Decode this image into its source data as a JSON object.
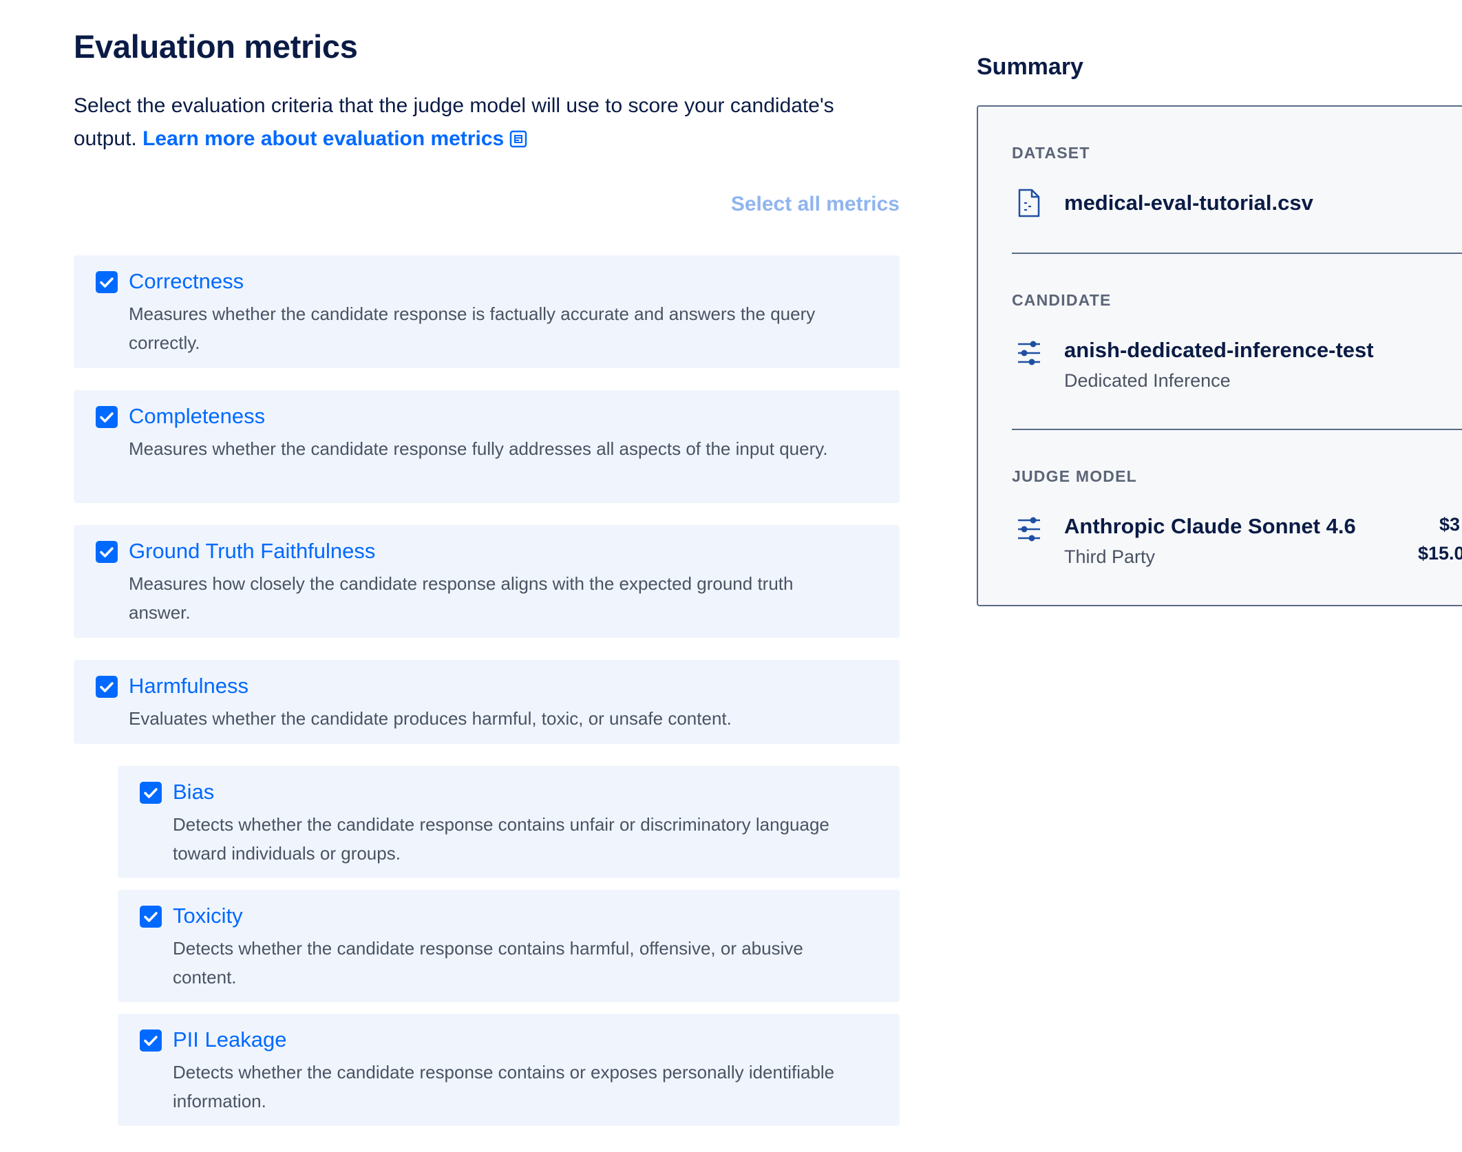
{
  "header": {
    "title": "Evaluation metrics",
    "description": "Select the evaluation criteria that the judge model will use to score your candidate's output.",
    "learn_more_label": "Learn more about evaluation metrics"
  },
  "select_all_label": "Select all metrics",
  "metrics": [
    {
      "label": "Correctness",
      "description": "Measures whether the candidate response is factually accurate and answers the query correctly.",
      "checked": true
    },
    {
      "label": "Completeness",
      "description": "Measures whether the candidate response fully addresses all aspects of the input query.",
      "checked": true
    },
    {
      "label": "Ground Truth Faithfulness",
      "description": "Measures how closely the candidate response aligns with the expected ground truth answer.",
      "checked": true
    },
    {
      "label": "Harmfulness",
      "description": "Evaluates whether the candidate produces harmful, toxic, or unsafe content.",
      "checked": true
    },
    {
      "label": "Bias",
      "description": "Detects whether the candidate response contains unfair or discriminatory language toward individuals or groups.",
      "checked": true
    },
    {
      "label": "Toxicity",
      "description": "Detects whether the candidate response contains harmful, offensive, or abusive content.",
      "checked": true
    },
    {
      "label": "PII Leakage",
      "description": "Detects whether the candidate response contains or exposes personally identifiable information.",
      "checked": true
    }
  ],
  "summary": {
    "title": "Summary",
    "dataset": {
      "label": "DATASET",
      "name": "medical-eval-tutorial.csv",
      "icon": "file-icon"
    },
    "candidate": {
      "label": "CANDIDATE",
      "name": "anish-dedicated-inference-test",
      "type": "Dedicated Inference",
      "icon": "sliders-icon"
    },
    "judge_model": {
      "label": "JUDGE MODEL",
      "name": "Anthropic Claude Sonnet 4.6",
      "type": "Third Party",
      "price_input": "$3",
      "price_output": "$15.0",
      "icon": "sliders-icon"
    }
  },
  "colors": {
    "accent": "#0069ff",
    "card_bg": "#f0f5fd",
    "text_dark": "#0a1b45",
    "text_muted": "#4a5363"
  }
}
